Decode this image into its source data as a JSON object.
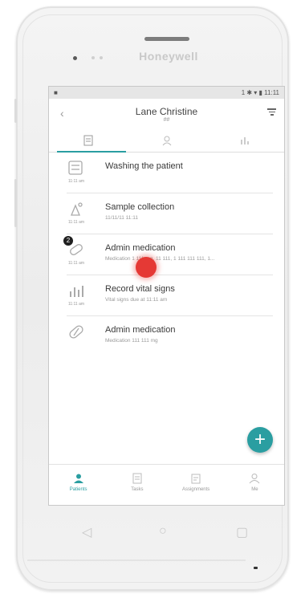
{
  "device": {
    "brand": "Honeywell"
  },
  "statusbar": {
    "left_icon": "■",
    "right_text": "1 ✱ ▾ ▮ 11:11"
  },
  "appbar": {
    "title": "Lane Christine",
    "subtitle": "##"
  },
  "tabs": [
    {
      "name": "document-icon",
      "active": true
    },
    {
      "name": "person-icon",
      "active": false
    },
    {
      "name": "chart-icon",
      "active": false
    }
  ],
  "list": {
    "items": [
      {
        "title": "Washing the patient",
        "subtitle": "",
        "caption": "11:11 am",
        "icon": "washing-icon"
      },
      {
        "title": "Sample collection",
        "subtitle": "11/11/11 11:11",
        "caption": "11:11 am",
        "icon": "sample-icon"
      },
      {
        "title": "Admin medication",
        "subtitle": "Medication 1 111 mg, 11 111, 1 111 111 111, 1...",
        "caption": "11:11 am",
        "icon": "medication-icon",
        "badge": "2"
      },
      {
        "title": "Record vital signs",
        "subtitle": "Vital signs due at 11:11 am",
        "caption": "11:11 am",
        "icon": "vitals-icon"
      },
      {
        "title": "Admin medication",
        "subtitle": "Medication 111 111 mg",
        "caption": "",
        "icon": "pill-icon"
      }
    ]
  },
  "fab": {
    "label": "+"
  },
  "bottom_nav": [
    {
      "label": "Patients",
      "icon": "patients-icon",
      "active": true
    },
    {
      "label": "Tasks",
      "icon": "tasks-icon",
      "active": false
    },
    {
      "label": "Assignments",
      "icon": "assignments-icon",
      "active": false
    },
    {
      "label": "Me",
      "icon": "me-icon",
      "active": false
    }
  ],
  "hardware_keys": {
    "back": "◁",
    "home": "○",
    "recents": "▢"
  },
  "colors": {
    "accent": "#2a9ea1",
    "touch_indicator": "#e53935"
  }
}
